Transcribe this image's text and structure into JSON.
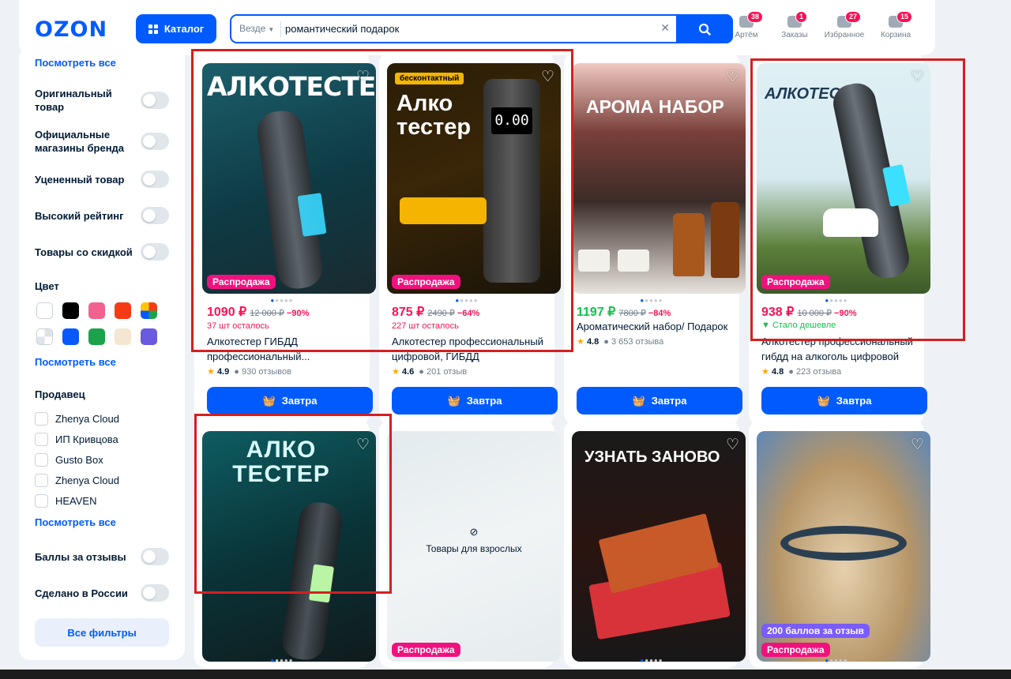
{
  "header": {
    "logo": "OZON",
    "catalog_label": "Каталог",
    "search_scope": "Везде",
    "search_value": "романтический подарок",
    "nav": [
      {
        "label": "Артём",
        "badge": "38"
      },
      {
        "label": "Заказы",
        "badge": "1"
      },
      {
        "label": "Избранное",
        "badge": "27"
      },
      {
        "label": "Корзина",
        "badge": "15"
      }
    ]
  },
  "sidebar": {
    "see_all_top": "Посмотреть все",
    "toggles_top": [
      "Оригинальный товар",
      "Официальные магазины бренда",
      "Уцененный товар",
      "Высокий рейтинг",
      "Товары со скидкой"
    ],
    "color_heading": "Цвет",
    "colors": [
      "#ffffff",
      "#000000",
      "#f2628f",
      "#f43b16",
      "multicolor",
      "checker",
      "#0a58ff",
      "#1aa34a",
      "#f4e6d0",
      "#6a5ae0"
    ],
    "see_all_colors": "Посмотреть все",
    "seller_heading": "Продавец",
    "sellers": [
      "Zhenya Cloud",
      "ИП Кривцова",
      "Gusto Box",
      "Zhenya Cloud",
      "HEAVEN"
    ],
    "see_all_sellers": "Посмотреть все",
    "toggles_bottom": [
      "Баллы за отзывы",
      "Сделано в России"
    ],
    "all_filters": "Все фильтры"
  },
  "products": [
    {
      "image_text": "АЛКОТЕСТЕР",
      "badge": "Распродажа",
      "price": "1090 ₽",
      "old_price": "12 000 ₽",
      "discount": "−90%",
      "note": "37 шт осталось",
      "title": "Алкотестер ГИБДД профессиональный...",
      "rating": "4.9",
      "reviews": "930 отзывов",
      "cart": "Завтра"
    },
    {
      "image_text": "Алко тестер",
      "badge": "Распродажа",
      "price": "875 ₽",
      "old_price": "2490 ₽",
      "discount": "−64%",
      "note": "227 шт осталось",
      "title": "Алкотестер профессиональный цифровой, ГИБДД",
      "rating": "4.6",
      "reviews": "201 отзыв",
      "cart": "Завтра"
    },
    {
      "image_text": "АРОМА НАБОР",
      "price": "1197 ₽",
      "old_price": "7800 ₽",
      "discount": "−84%",
      "title": "Ароматический набор/ Подарок",
      "rating": "4.8",
      "reviews": "3 653 отзыва",
      "cart": "Завтра"
    },
    {
      "image_text": "АЛКОТЕСТЕР",
      "badge": "Распродажа",
      "price": "938 ₽",
      "old_price": "10 000 ₽",
      "discount": "−90%",
      "note": "Стало дешевле",
      "title": "Алкотестер профессиональный гибдд на алкоголь цифровой",
      "rating": "4.8",
      "reviews": "223 отзыва",
      "cart": "Завтра"
    },
    {
      "image_text": "АЛКО ТЕСТЕР"
    },
    {
      "adult_label": "Товары для взрослых",
      "badge": "Распродажа"
    },
    {
      "image_text": "УЗНАТЬ ЗАНОВО"
    },
    {
      "points_badge": "200 баллов за отзыв",
      "badge": "Распродажа"
    }
  ]
}
